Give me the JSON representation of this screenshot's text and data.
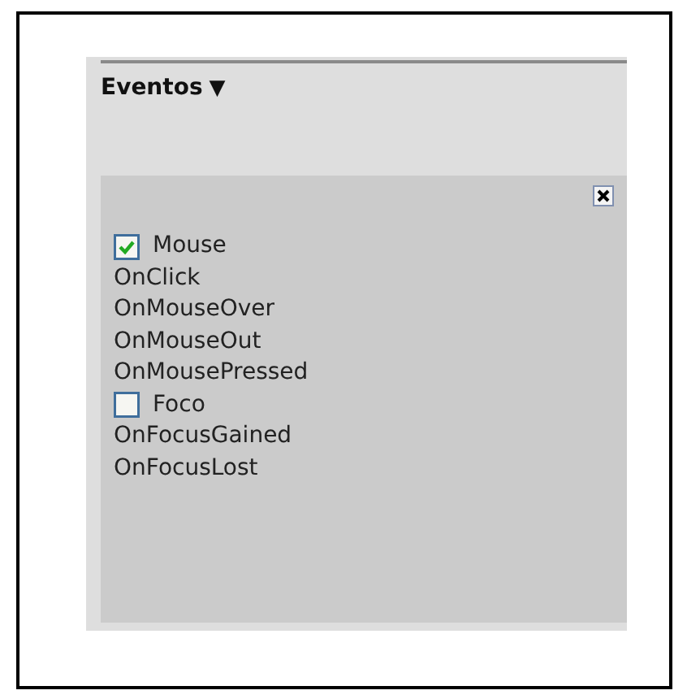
{
  "panel": {
    "title": "Eventos",
    "caret": "▼"
  },
  "groups": [
    {
      "label": "Mouse",
      "checked": true,
      "events": [
        "OnClick",
        "OnMouseOver",
        "OnMouseOut",
        "OnMousePressed"
      ]
    },
    {
      "label": "Foco",
      "checked": false,
      "events": [
        "OnFocusGained",
        "OnFocusLost"
      ]
    }
  ]
}
